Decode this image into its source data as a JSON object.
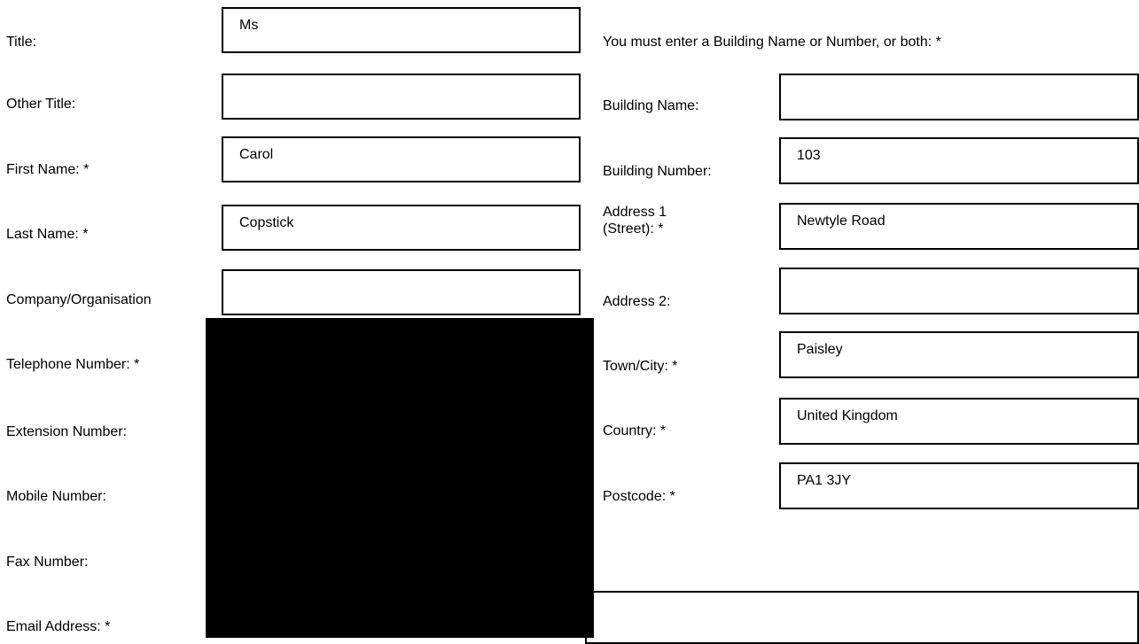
{
  "left": {
    "title_label": "Title:",
    "title_value": "Ms",
    "other_title_label": "Other Title:",
    "other_title_value": "",
    "first_name_label": "First Name: *",
    "first_name_value": "Carol",
    "last_name_label": "Last Name: *",
    "last_name_value": "Copstick",
    "company_label": "Company/Organisation",
    "company_value": "",
    "telephone_label": "Telephone Number: *",
    "extension_label": "Extension Number:",
    "mobile_label": "Mobile Number:",
    "fax_label": "Fax Number:",
    "email_label": "Email Address: *"
  },
  "right": {
    "note": "You must enter a Building Name or Number, or both: *",
    "building_name_label": "Building Name:",
    "building_name_value": "",
    "building_number_label": "Building Number:",
    "building_number_value": "103",
    "address1_label_line1": "Address 1",
    "address1_label_line2": "(Street): *",
    "address1_value": "Newtyle Road",
    "address2_label": "Address 2:",
    "address2_value": "",
    "town_label": "Town/City: *",
    "town_value": "Paisley",
    "country_label": "Country: *",
    "country_value": "United Kingdom",
    "postcode_label": "Postcode: *",
    "postcode_value": "PA1 3JY",
    "extra_value": ""
  }
}
